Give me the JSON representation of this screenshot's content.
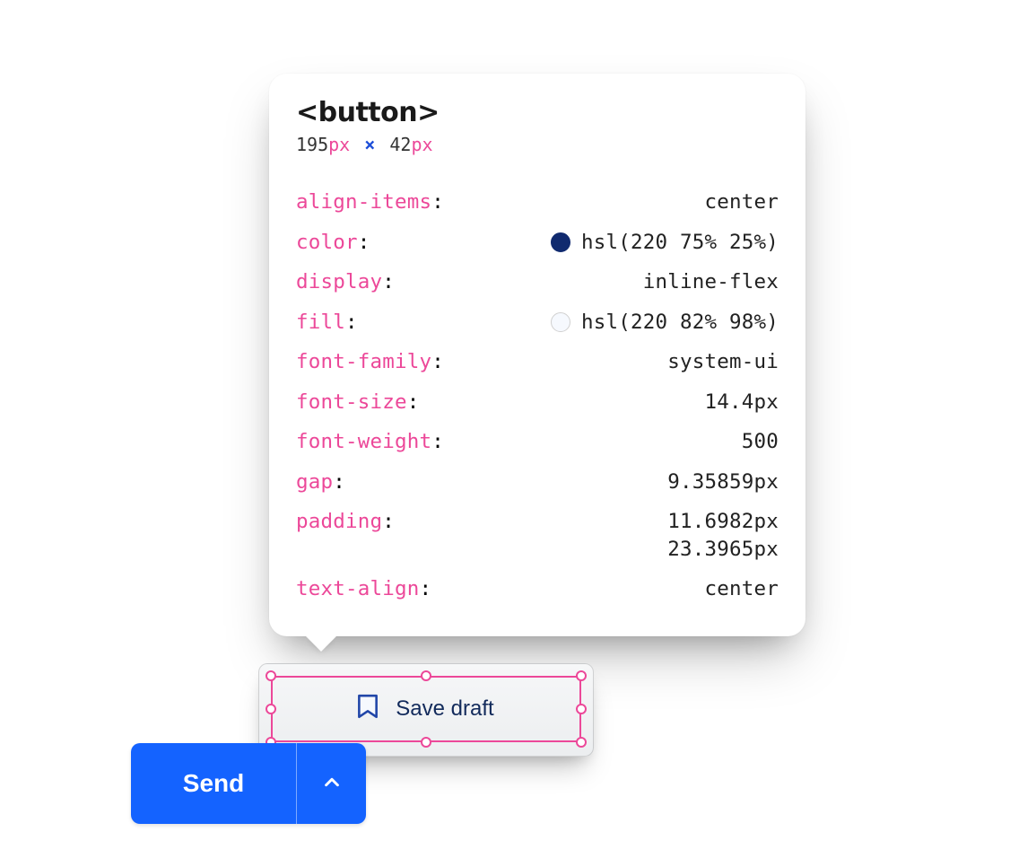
{
  "inspector": {
    "element_tag": "<button>",
    "dimensions": {
      "width_value": "195",
      "width_unit": "px",
      "sep": "×",
      "height_value": "42",
      "height_unit": "px"
    },
    "properties": [
      {
        "name": "align-items",
        "value": "center"
      },
      {
        "name": "color",
        "value": "hsl(220 75% 25%)",
        "swatch": "#102a6f"
      },
      {
        "name": "display",
        "value": "inline-flex"
      },
      {
        "name": "fill",
        "value": "hsl(220 82% 98%)",
        "swatch": "#f6f9fe"
      },
      {
        "name": "font-family",
        "value": "system-ui"
      },
      {
        "name": "font-size",
        "value": "14.4px"
      },
      {
        "name": "font-weight",
        "value": "500"
      },
      {
        "name": "gap",
        "value": "9.35859px"
      },
      {
        "name": "padding",
        "value": "11.6982px",
        "value2": "23.3965px"
      },
      {
        "name": "text-align",
        "value": "center"
      }
    ]
  },
  "popover": {
    "save_draft_label": "Save draft"
  },
  "send_button": {
    "label": "Send"
  },
  "icons": {
    "bookmark": "bookmark-icon",
    "chevron_up": "chevron-up-icon"
  },
  "colors": {
    "pink": "#ec4899",
    "blue": "#1463FF",
    "navy_text": "#122a5b"
  }
}
